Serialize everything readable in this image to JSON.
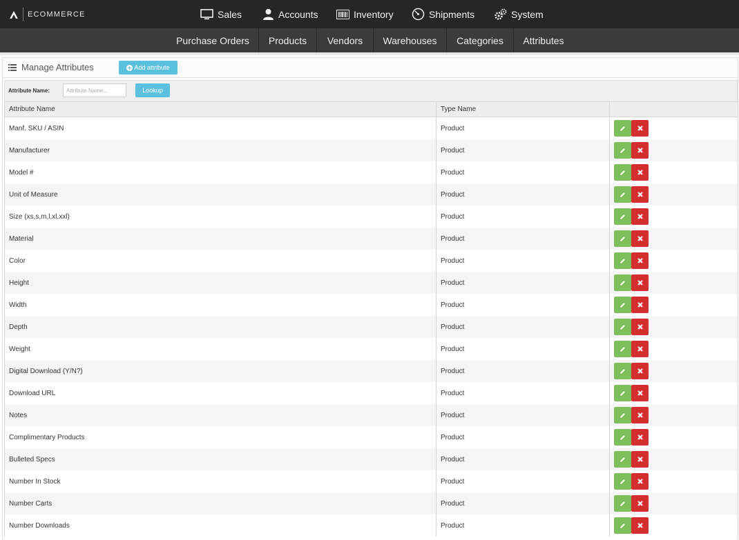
{
  "brand": {
    "name": "ECOMMERCE"
  },
  "top_nav": [
    {
      "label": "Sales",
      "icon": "monitor-icon"
    },
    {
      "label": "Accounts",
      "icon": "user-icon"
    },
    {
      "label": "Inventory",
      "icon": "barcode-icon"
    },
    {
      "label": "Shipments",
      "icon": "speedometer-icon"
    },
    {
      "label": "System",
      "icon": "gears-icon"
    }
  ],
  "sub_nav": [
    "Purchase Orders",
    "Products",
    "Vendors",
    "Warehouses",
    "Categories",
    "Attributes"
  ],
  "panel": {
    "title": "Manage Attributes",
    "add_label": "Add attribute"
  },
  "search": {
    "label": "Attribute Name:",
    "placeholder": "Attribute Name...",
    "button": "Lookup"
  },
  "table": {
    "headers": [
      "Attribute Name",
      "Type Name",
      ""
    ],
    "rows": [
      {
        "name": "Manf. SKU / ASIN",
        "type": "Product"
      },
      {
        "name": "Manufacturer",
        "type": "Product"
      },
      {
        "name": "Model #",
        "type": "Product"
      },
      {
        "name": "Unit of Measure",
        "type": "Product"
      },
      {
        "name": "Size (xs,s,m,l,xl,xxl)",
        "type": "Product"
      },
      {
        "name": "Material",
        "type": "Product"
      },
      {
        "name": "Color",
        "type": "Product"
      },
      {
        "name": "Height",
        "type": "Product"
      },
      {
        "name": "Width",
        "type": "Product"
      },
      {
        "name": "Depth",
        "type": "Product"
      },
      {
        "name": "Weight",
        "type": "Product"
      },
      {
        "name": "Digital Download (Y/N?)",
        "type": "Product"
      },
      {
        "name": "Download URL",
        "type": "Product"
      },
      {
        "name": "Notes",
        "type": "Product"
      },
      {
        "name": "Complimentary Products",
        "type": "Product"
      },
      {
        "name": "Bulleted Specs",
        "type": "Product"
      },
      {
        "name": "Number In Stock",
        "type": "Product"
      },
      {
        "name": "Number Carts",
        "type": "Product"
      },
      {
        "name": "Number Downloads",
        "type": "Product"
      }
    ]
  },
  "colors": {
    "topbar": "#262626",
    "subbar": "#3b3b3b",
    "info_button": "#5bc0de",
    "edit_button": "#7ebf5b",
    "delete_button": "#d32f2f"
  }
}
